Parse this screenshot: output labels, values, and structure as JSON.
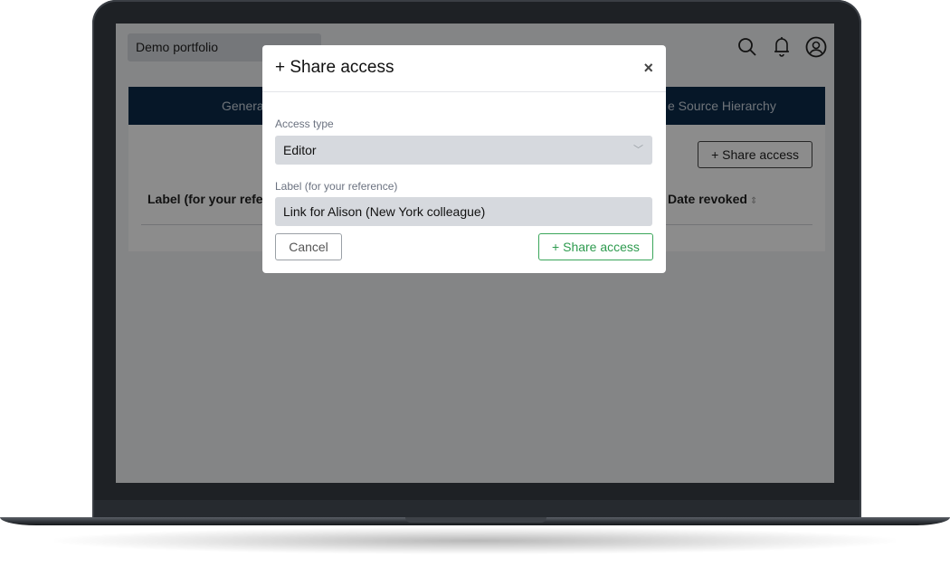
{
  "app": {
    "portfolio_selector": "Demo portfolio",
    "tabs": {
      "left_visible": "Genera",
      "right_visible": "e Source Hierarchy"
    },
    "share_access_button": "+ Share access",
    "table": {
      "col_label_visible": "Label (for your refere",
      "col_date_revoked": "Date revoked"
    },
    "icons": [
      "search-icon",
      "bell-icon",
      "user-circle-icon"
    ]
  },
  "modal": {
    "title": "+ Share access",
    "close_glyph": "×",
    "access_type_label": "Access type",
    "access_type_value": "Editor",
    "label_field_label": "Label (for your reference)",
    "label_field_value": "Link for Alison (New York colleague)",
    "cancel_label": "Cancel",
    "submit_label": "+ Share access",
    "colors": {
      "submit": "#2e9b4f",
      "header_bar": "#0b2b4a"
    }
  }
}
